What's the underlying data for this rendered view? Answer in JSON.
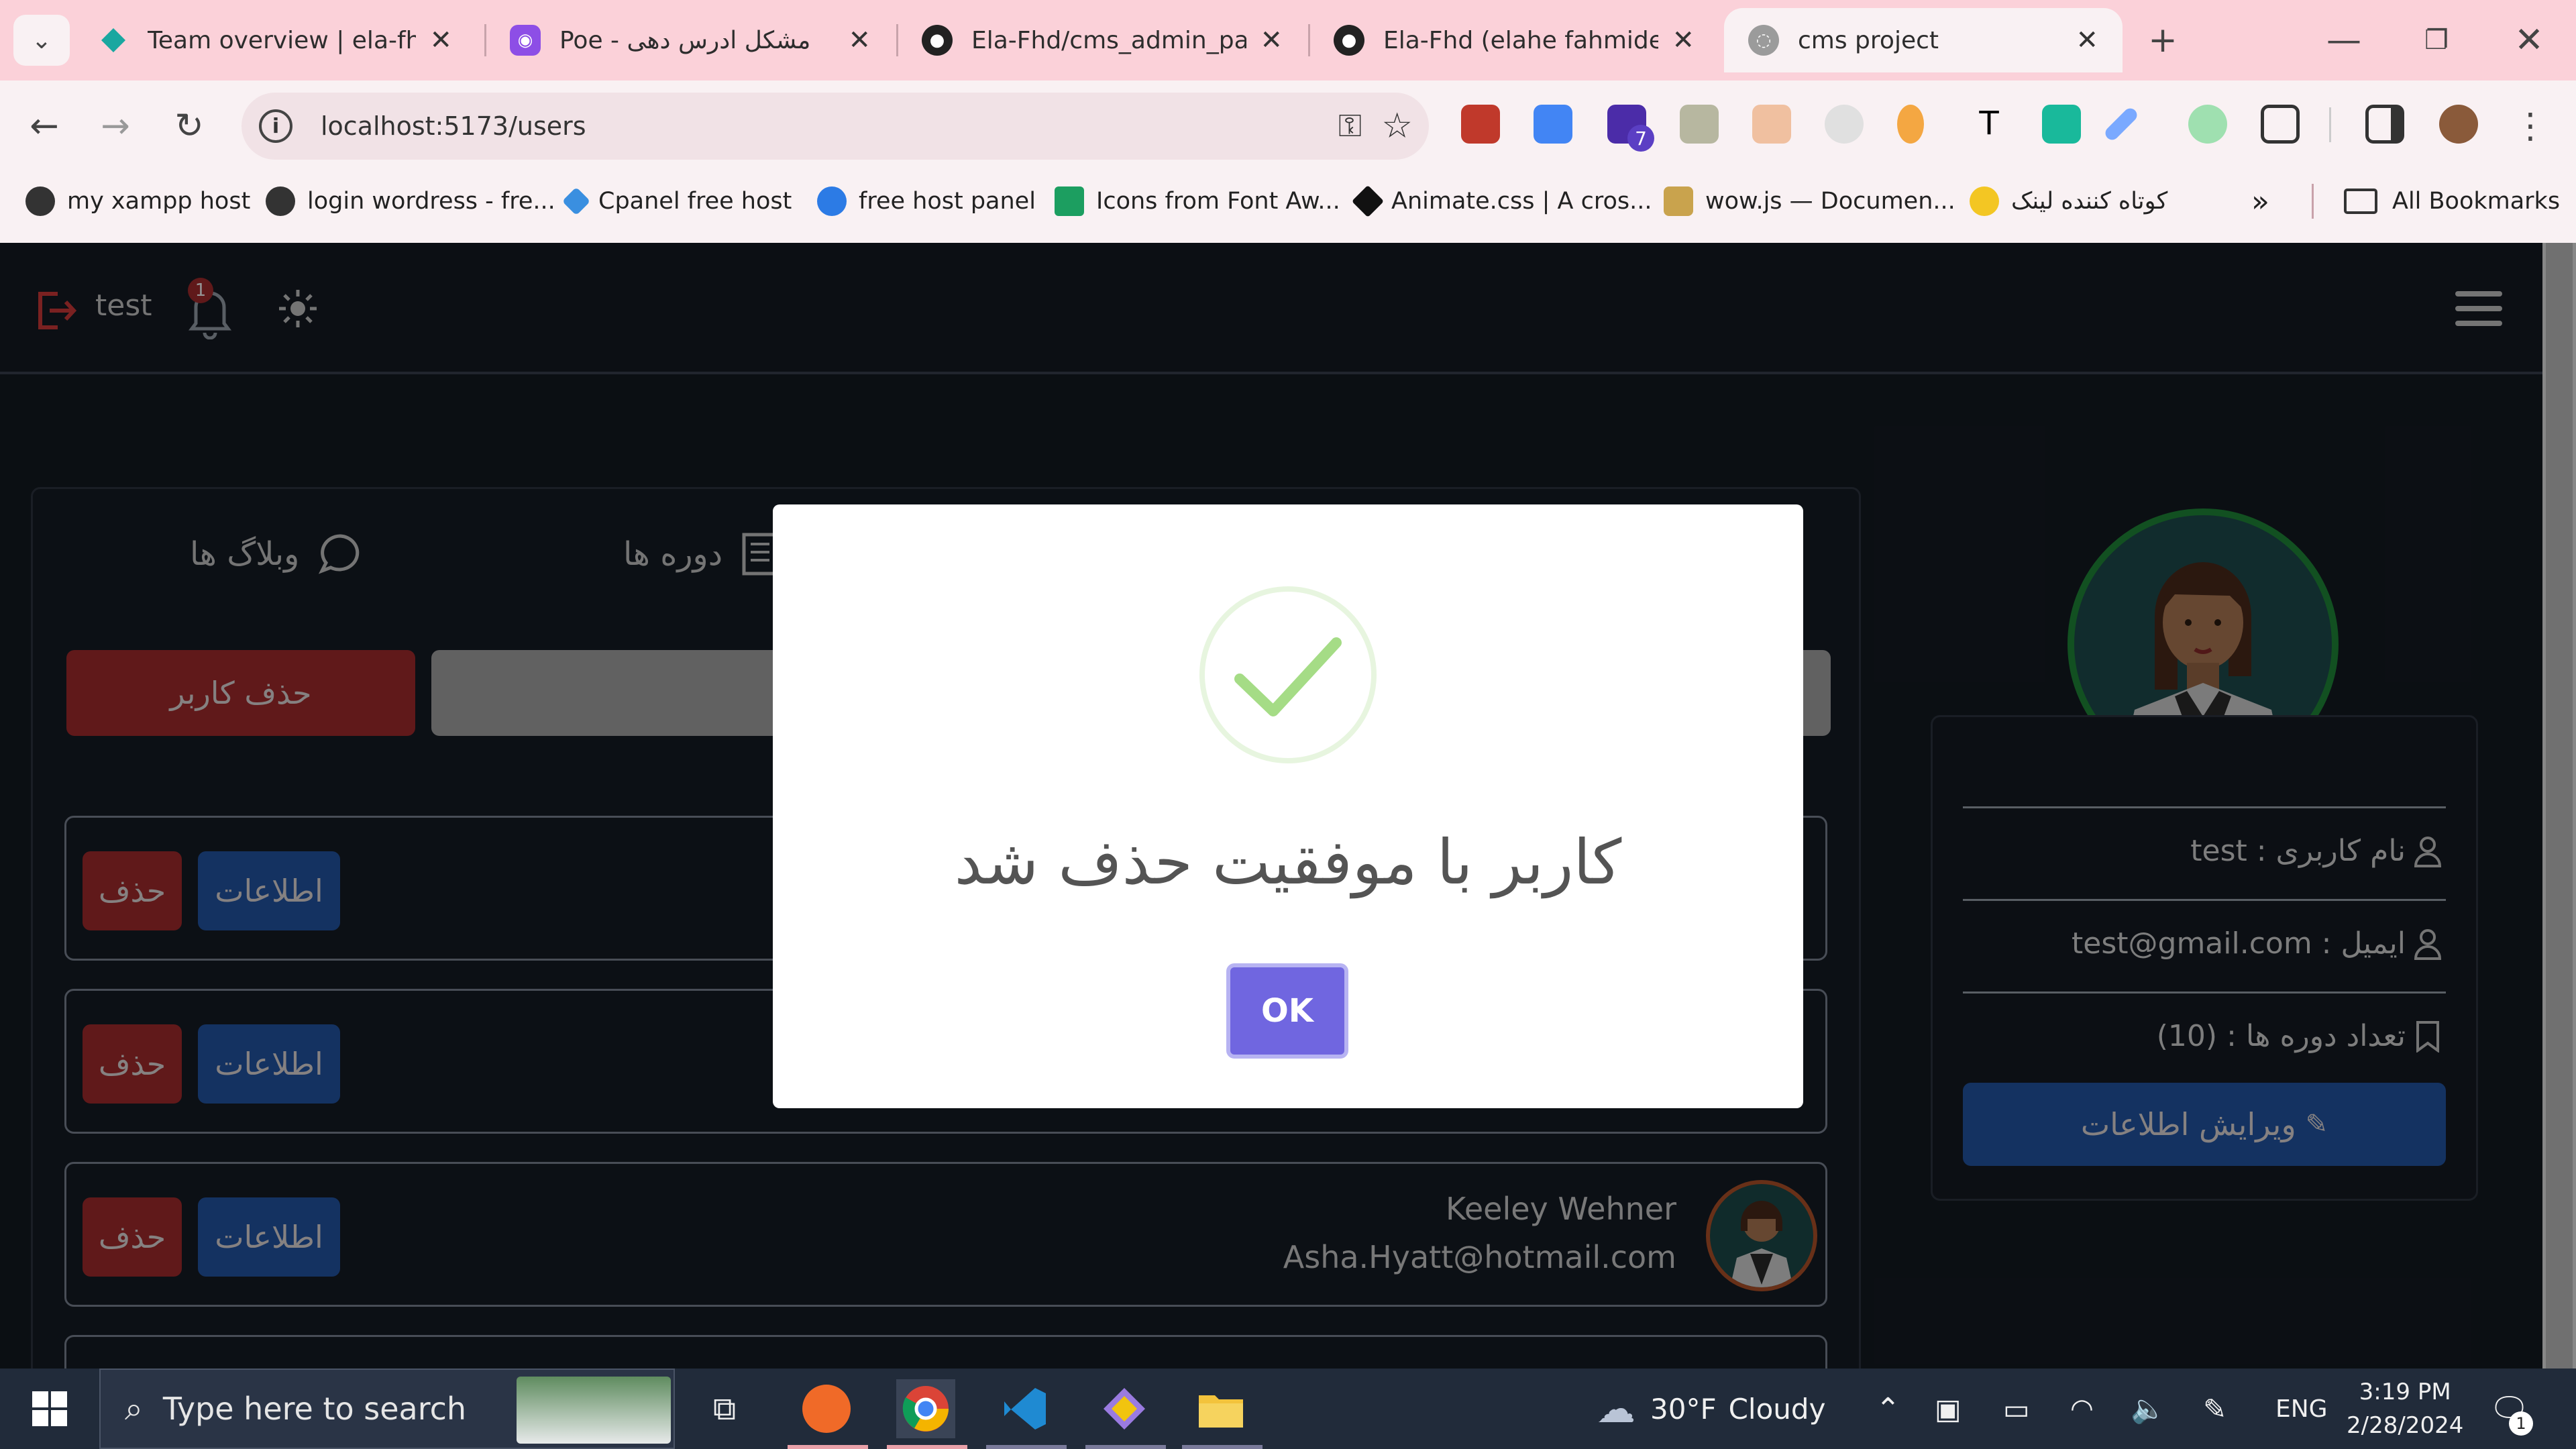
{
  "browser": {
    "tabs": [
      {
        "label": "Team overview | ela-fhd |",
        "favicon": "diamond-icon",
        "color": "#1aa7a0"
      },
      {
        "label": "Poe - مشکل ادرس دهی",
        "favicon": "poe-icon",
        "color": "#8d4ee6"
      },
      {
        "label": "Ela-Fhd/cms_admin_pane",
        "favicon": "github-icon",
        "color": "#222222"
      },
      {
        "label": "Ela-Fhd (elahe fahmideh)",
        "favicon": "github-icon",
        "color": "#222222"
      },
      {
        "label": "cms project",
        "favicon": "globe-icon",
        "color": "#8a8a8a"
      }
    ],
    "url": "localhost:5173/users",
    "bookmarks": [
      {
        "label": "my xampp host"
      },
      {
        "label": "login wordress - fre..."
      },
      {
        "label": "Cpanel free host"
      },
      {
        "label": "free host panel"
      },
      {
        "label": "Icons from Font Aw..."
      },
      {
        "label": "Animate.css | A cros..."
      },
      {
        "label": "wow.js — Documen..."
      },
      {
        "label": "کوتاه کننده لینک"
      }
    ],
    "all_bookmarks": "All Bookmarks",
    "extension_badge": "7"
  },
  "app": {
    "username": "test",
    "notification_count": "1",
    "tabs": [
      {
        "label": "وبلاگ ها"
      },
      {
        "label": "دوره ها"
      }
    ],
    "delete_user_button": "حذف کاربر",
    "users": [
      {
        "name": "",
        "email": "",
        "info_label": "اطلاعات",
        "delete_label": "حذف"
      },
      {
        "name": "",
        "email": "",
        "info_label": "اطلاعات",
        "delete_label": "حذف"
      },
      {
        "name": "Keeley Wehner",
        "email": "Asha.Hyatt@hotmail.com",
        "info_label": "اطلاعات",
        "delete_label": "حذف"
      }
    ],
    "profile": {
      "username_row": "نام کاربری : test",
      "email_row": "ایمیل : test@gmail.com",
      "courses_row": "تعداد دوره ها : (10)",
      "edit_button": "ویرایش اطلاعات"
    }
  },
  "modal": {
    "title": "کاربر با موفقیت حذف شد",
    "ok": "OK",
    "success_color": "#a5dc86"
  },
  "taskbar": {
    "search_placeholder": "Type here to search",
    "weather_temp": "30°F",
    "weather_text": "Cloudy",
    "language": "ENG",
    "time": "3:19 PM",
    "date": "2/28/2024",
    "notification_count": "1"
  }
}
